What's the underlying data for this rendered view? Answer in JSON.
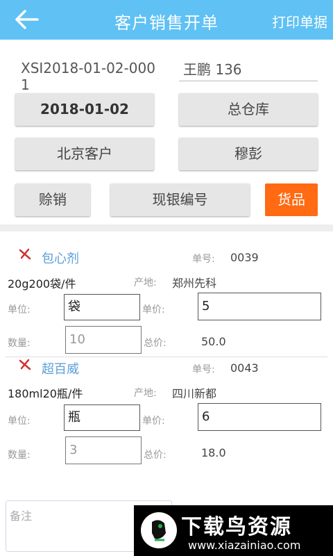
{
  "header": {
    "title": "客户销售开单",
    "action": "打印单据"
  },
  "form": {
    "doc_no": "XSI2018-01-02-0001",
    "operator": "王鹏 136",
    "date": "2018-01-02",
    "warehouse": "总仓库",
    "customer": "北京客户",
    "salesperson": "穆彭",
    "pay_type": "赊销",
    "cash_no_label": "现银编号",
    "goods_button": "货品"
  },
  "labels": {
    "order_no": "单号:",
    "origin": "产地:",
    "unit": "单位:",
    "unit_price": "单价:",
    "quantity": "数量:",
    "total": "总价:"
  },
  "items": [
    {
      "name": "包心剂",
      "order_no": "0039",
      "spec": "20g200袋/件",
      "origin": "郑州先科",
      "unit": "袋",
      "unit_price": "5",
      "quantity": "10",
      "total": "50.0"
    },
    {
      "name": "超百威",
      "order_no": "0043",
      "spec": "180ml20瓶/件",
      "origin": "四川新都",
      "unit": "瓶",
      "unit_price": "6",
      "quantity": "3",
      "total": "18.0"
    }
  ],
  "remark": {
    "placeholder": "备注"
  },
  "watermark": {
    "title": "下载鸟资源",
    "url": "www.xiazainiao.com"
  },
  "colors": {
    "header": "#5fc1f4",
    "accent": "#ff6a13",
    "link": "#5b9fd9",
    "delete": "#d03030"
  }
}
